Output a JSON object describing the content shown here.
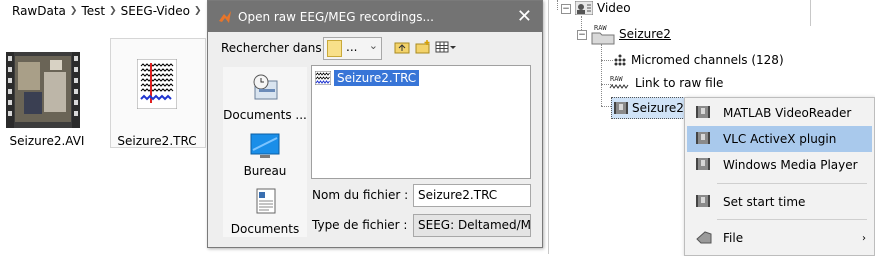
{
  "explorer": {
    "breadcrumb": [
      "RawData",
      "Test",
      "SEEG-Video"
    ],
    "files": [
      {
        "name": "Seizure2.AVI",
        "icon": "video-thumbnail"
      },
      {
        "name": "Seizure2.TRC",
        "icon": "trc-file-icon"
      }
    ]
  },
  "dialog": {
    "title": "Open raw EEG/MEG recordings...",
    "close": "✕",
    "look_in_label": "Rechercher dans :",
    "look_in_value": "...",
    "places": [
      "Documents ...",
      "Bureau",
      "Documents"
    ],
    "files": [
      "Seizure2.TRC"
    ],
    "filename_label": "Nom du fichier :",
    "filename_value": "Seizure2.TRC",
    "filetype_label": "Type de fichier :",
    "filetype_value": "SEEG: Deltamed/Micromed"
  },
  "tree": {
    "root": "Video",
    "subject": "Seizure2",
    "children": [
      "Micromed channels (128)",
      "Link to raw file",
      "Seizure2"
    ]
  },
  "context_menu": {
    "items": [
      {
        "label": "MATLAB VideoReader",
        "highlighted": false
      },
      {
        "label": "VLC ActiveX plugin",
        "highlighted": true
      },
      {
        "label": "Windows Media Player",
        "highlighted": false
      },
      {
        "label": "Set start time",
        "highlighted": false
      },
      {
        "label": "File",
        "highlighted": false,
        "submenu": "›"
      }
    ]
  },
  "colors": {
    "dialog_title": "#737373",
    "selection": "#3875d7",
    "menu_highlight": "#a9c9ec"
  }
}
